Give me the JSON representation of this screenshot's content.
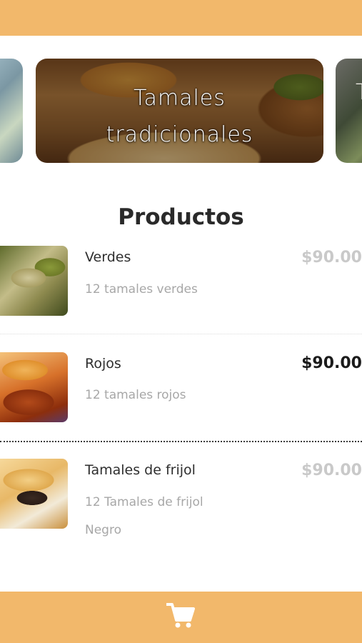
{
  "carousel": {
    "main_card_title_line1": "Tamales",
    "main_card_title_line2": "tradicionales",
    "right_card_partial_text": "T"
  },
  "section": {
    "title": "Productos"
  },
  "products": [
    {
      "name": "Verdes",
      "description": "12 tamales verdes",
      "price": "$90.00",
      "price_state": "muted"
    },
    {
      "name": "Rojos",
      "description": "12 tamales rojos",
      "price": "$90.00",
      "price_state": "active"
    },
    {
      "name": "Tamales de frijol",
      "description": "12 Tamales de frijol Negro",
      "price": "$90.00",
      "price_state": "muted"
    }
  ],
  "bottom_bar": {
    "icon": "cart-icon"
  },
  "colors": {
    "brand": "#f2b86b",
    "price_muted": "#c9c9c9",
    "price_active": "#1b1b1b",
    "text_secondary": "#a7a7a7"
  }
}
